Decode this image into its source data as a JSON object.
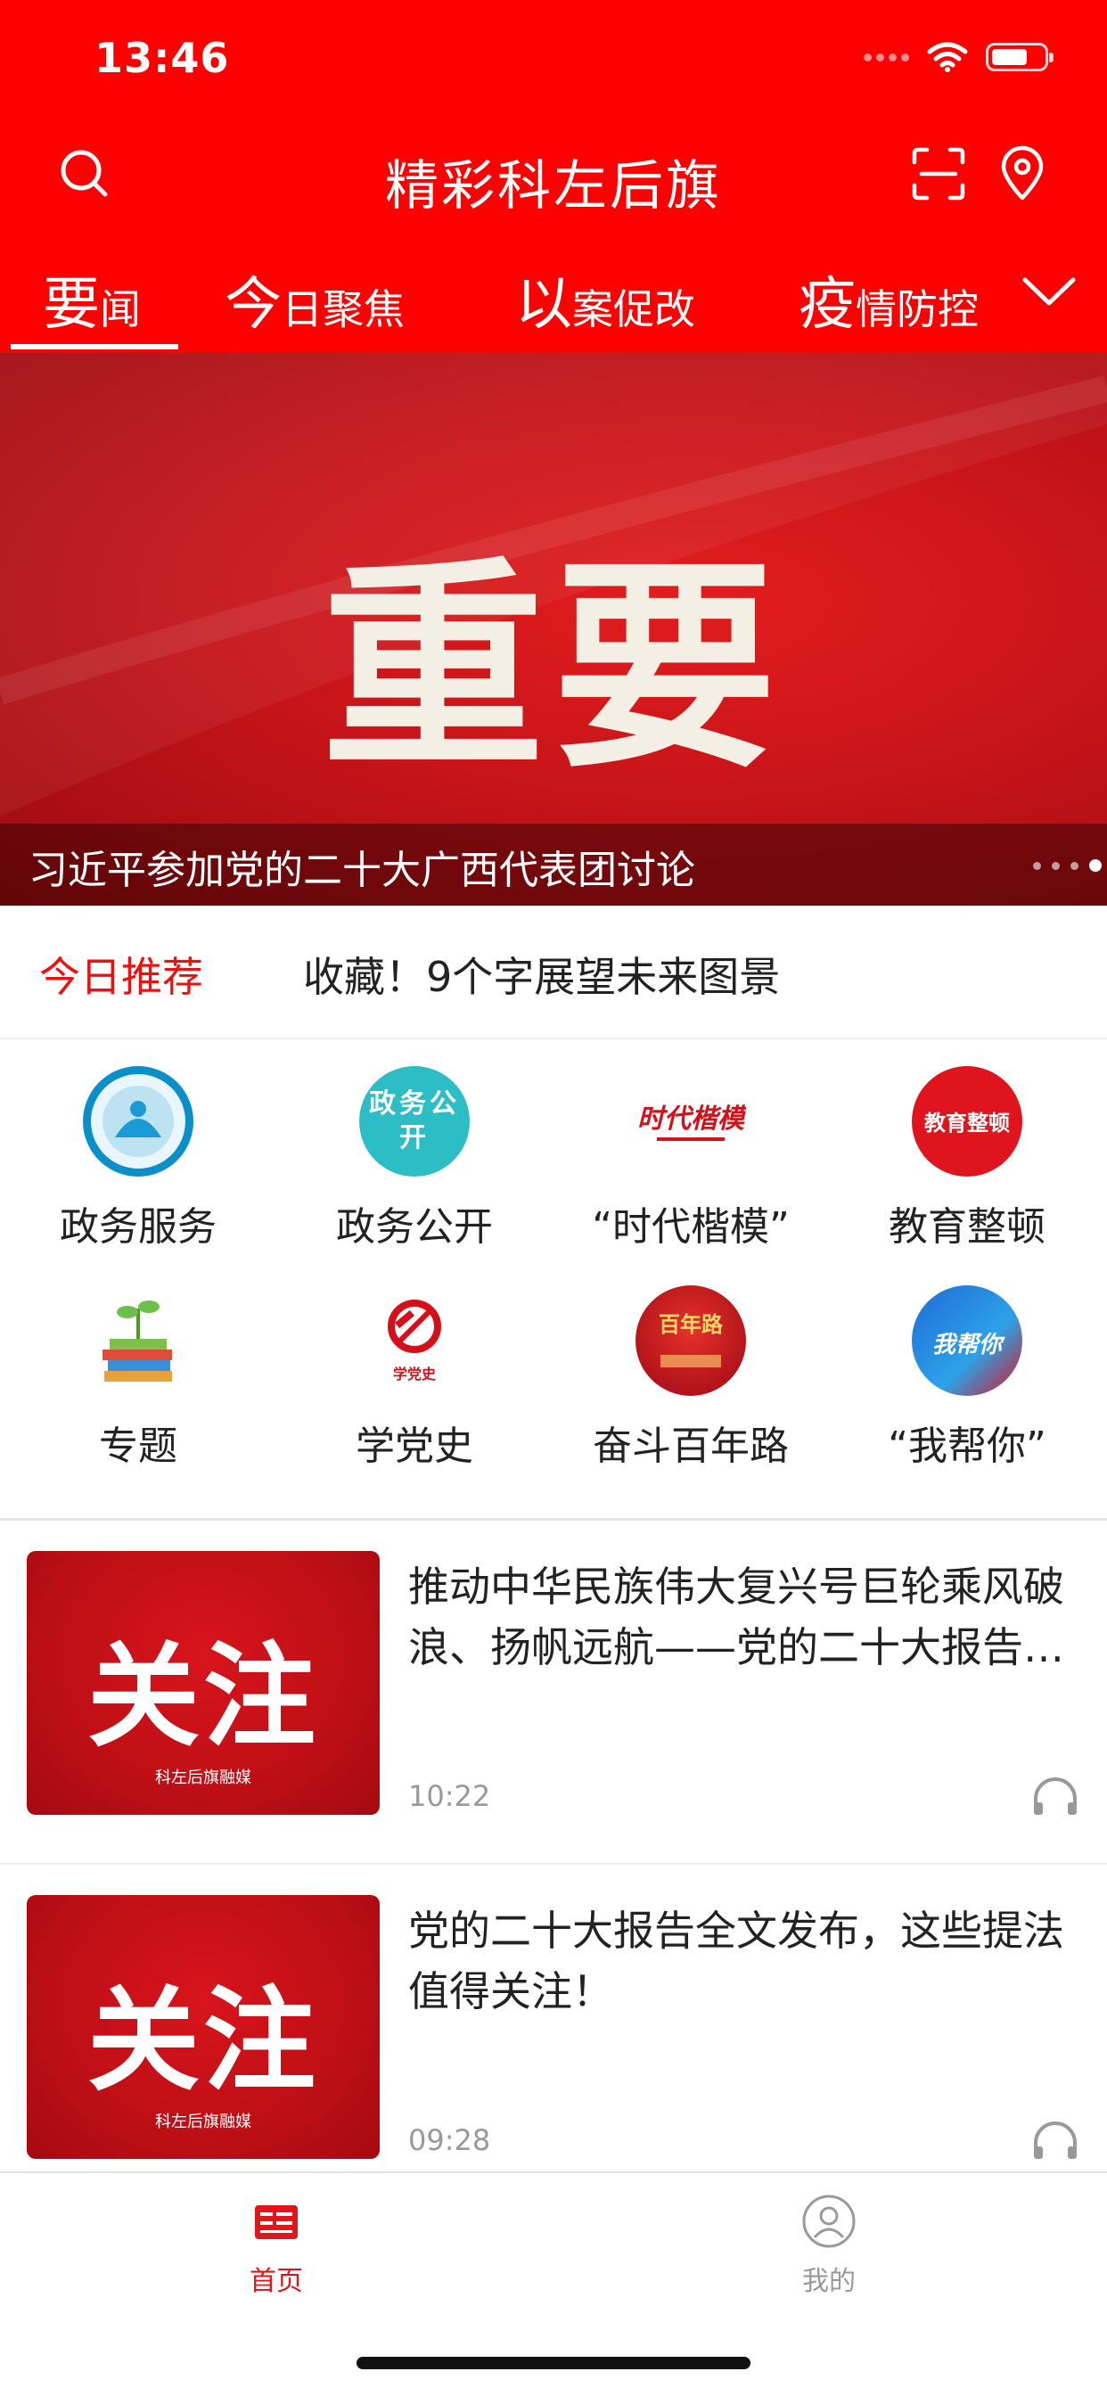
{
  "status_bar": {
    "time": "13:46",
    "battery_percent": 70
  },
  "header": {
    "title": "精彩科左后旗",
    "icons": [
      "search-icon",
      "scan-icon",
      "location-icon"
    ],
    "brand_color": "#fe0000"
  },
  "tabs": [
    {
      "big": "要",
      "small": "闻",
      "active": true
    },
    {
      "big": "今",
      "small": "日聚焦",
      "active": false
    },
    {
      "big": "以",
      "small": "案促改",
      "active": false
    },
    {
      "big": "疫",
      "small": "情防控",
      "active": false
    }
  ],
  "banner": {
    "image_text": "重要",
    "caption": "习近平参加党的二十大广西代表团讨论",
    "slide_count": 4,
    "active_slide": 4
  },
  "recommend": {
    "label": "今日推荐",
    "headline": "收藏！9个字展望未来图景"
  },
  "grid": [
    {
      "label": "政务服务",
      "icon": "gov-service-icon",
      "icon_text": ""
    },
    {
      "label": "政务公开",
      "icon": "gov-public-icon",
      "icon_text": "政务公开"
    },
    {
      "label": "“时代楷模”",
      "icon": "era-model-icon",
      "icon_text": "时代楷模"
    },
    {
      "label": "教育整顿",
      "icon": "education-rectify-icon",
      "icon_text": "教育整顿"
    },
    {
      "label": "专题",
      "icon": "topic-icon",
      "icon_text": ""
    },
    {
      "label": "学党史",
      "icon": "party-history-icon",
      "icon_text": "学党史"
    },
    {
      "label": "奋斗百年路",
      "icon": "century-road-icon",
      "icon_text": "百年路"
    },
    {
      "label": "“我帮你”",
      "icon": "we-help-icon",
      "icon_text": "我帮你"
    }
  ],
  "news": [
    {
      "thumb_text": "关注",
      "thumb_logo": "科左后旗融媒",
      "title": "推动中华民族伟大复兴号巨轮乘风破浪、扬帆远航——党的二十大报告引起热烈反响",
      "time": "10:22"
    },
    {
      "thumb_text": "关注",
      "thumb_logo": "科左后旗融媒",
      "title": "党的二十大报告全文发布，这些提法值得关注！",
      "time": "09:28"
    }
  ],
  "tabbar": [
    {
      "label": "首页",
      "icon": "home-news-icon",
      "active": true,
      "color": "#e0161b"
    },
    {
      "label": "我的",
      "icon": "profile-icon",
      "active": false,
      "color": "#999999"
    }
  ]
}
